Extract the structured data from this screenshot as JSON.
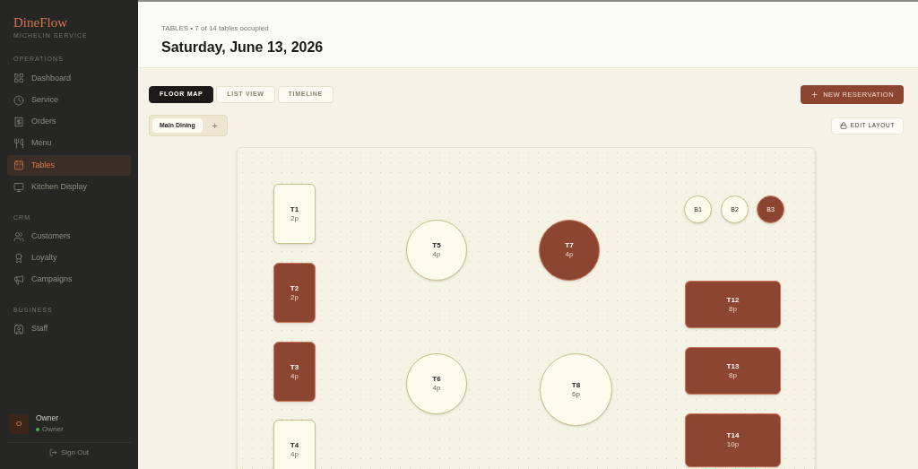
{
  "sidebar": {
    "brand": "DineFlow",
    "tagline": "MICHELIN SERVICE",
    "sections": [
      {
        "title": "OPERATIONS",
        "items": [
          {
            "label": "Dashboard",
            "selected": false
          },
          {
            "label": "Service",
            "selected": false
          },
          {
            "label": "Orders",
            "selected": false
          },
          {
            "label": "Menu",
            "selected": false
          },
          {
            "label": "Tables",
            "selected": true
          },
          {
            "label": "Kitchen Display",
            "selected": false
          }
        ]
      },
      {
        "title": "CRM",
        "items": [
          {
            "label": "Customers",
            "selected": false
          },
          {
            "label": "Loyalty",
            "selected": false
          },
          {
            "label": "Campaigns",
            "selected": false
          }
        ]
      },
      {
        "title": "BUSINESS",
        "items": [
          {
            "label": "Staff",
            "selected": false
          }
        ]
      }
    ],
    "user": {
      "initial": "O",
      "name": "Owner",
      "role": "Owner",
      "online": true
    },
    "sign_out": "Sign Out"
  },
  "header": {
    "subtitle": "TABLES • 7 of 14 tables occupied",
    "title": "Saturday, June 13, 2026"
  },
  "view_tabs": [
    {
      "label": "FLOOR MAP",
      "selected": true
    },
    {
      "label": "LIST VIEW",
      "selected": false
    },
    {
      "label": "TIMELINE",
      "selected": false
    }
  ],
  "new_reservation": "NEW RESERVATION",
  "rooms": [
    {
      "label": "Main Dining",
      "selected": true
    }
  ],
  "add_room": "+",
  "edit_layout": "EDIT LAYOUT",
  "tables": [
    {
      "name": "T1",
      "seats": "2p",
      "kind": "rect",
      "occupied": false
    },
    {
      "name": "T2",
      "seats": "2p",
      "kind": "rect",
      "occupied": true
    },
    {
      "name": "T3",
      "seats": "4p",
      "kind": "rect",
      "occupied": true
    },
    {
      "name": "T4",
      "seats": "4p",
      "kind": "rect",
      "occupied": false
    },
    {
      "name": "T5",
      "seats": "4p",
      "kind": "round",
      "occupied": false
    },
    {
      "name": "T6",
      "seats": "4p",
      "kind": "round",
      "occupied": false
    },
    {
      "name": "T7",
      "seats": "4p",
      "kind": "round",
      "occupied": true
    },
    {
      "name": "T8",
      "seats": "6p",
      "kind": "round",
      "occupied": false
    },
    {
      "name": "B1",
      "kind": "stool",
      "occupied": false
    },
    {
      "name": "B2",
      "kind": "stool",
      "occupied": false
    },
    {
      "name": "B3",
      "kind": "stool",
      "occupied": true
    },
    {
      "name": "T12",
      "seats": "8p",
      "kind": "rect",
      "occupied": true
    },
    {
      "name": "T13",
      "seats": "8p",
      "kind": "rect",
      "occupied": true
    },
    {
      "name": "T14",
      "seats": "10p",
      "kind": "rect",
      "occupied": true
    }
  ]
}
